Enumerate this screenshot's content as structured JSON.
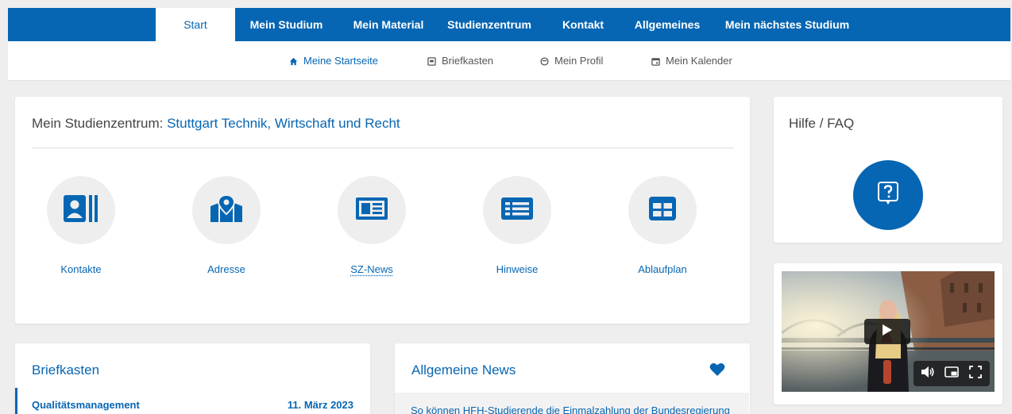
{
  "top_nav": {
    "tabs": [
      {
        "label": "Start",
        "active": true
      },
      {
        "label": "Mein Studium"
      },
      {
        "label": "Mein Material"
      },
      {
        "label": "Studienzentrum"
      },
      {
        "label": "Kontakt"
      },
      {
        "label": "Allgemeines"
      },
      {
        "label": "Mein nächstes Studium"
      }
    ]
  },
  "sub_nav": {
    "items": [
      {
        "label": "Meine Startseite",
        "icon": "home-icon",
        "active": true
      },
      {
        "label": "Briefkasten",
        "icon": "mailbox-icon"
      },
      {
        "label": "Mein Profil",
        "icon": "profile-icon"
      },
      {
        "label": "Mein Kalender",
        "icon": "calendar-icon"
      }
    ]
  },
  "studienzentrum": {
    "prefix": "Mein Studienzentrum: ",
    "name": "Stuttgart Technik, Wirtschaft und Recht",
    "tiles": [
      {
        "label": "Kontakte",
        "icon": "contact-card-icon"
      },
      {
        "label": "Adresse",
        "icon": "map-pin-icon"
      },
      {
        "label": "SZ-News",
        "icon": "newspaper-icon"
      },
      {
        "label": "Hinweise",
        "icon": "notes-list-icon"
      },
      {
        "label": "Ablaufplan",
        "icon": "grid-plan-icon"
      }
    ]
  },
  "help": {
    "title": "Hilfe / FAQ",
    "icon": "question-icon"
  },
  "video": {
    "controls": [
      "volume-icon",
      "picture-in-picture-icon",
      "fullscreen-icon"
    ],
    "play_icon": "play-icon"
  },
  "briefkasten": {
    "title": "Briefkasten",
    "items": [
      {
        "subject": "Qualitätsmanagement",
        "date": "11. März 2023"
      }
    ]
  },
  "news": {
    "title": "Allgemeine News",
    "icon": "heart-icon",
    "items": [
      {
        "text": "So können HFH-Studierende die Einmalzahlung der Bundesregierung"
      }
    ]
  },
  "colors": {
    "primary": "#0766b3",
    "background": "#eeeeee",
    "card": "#ffffff"
  }
}
